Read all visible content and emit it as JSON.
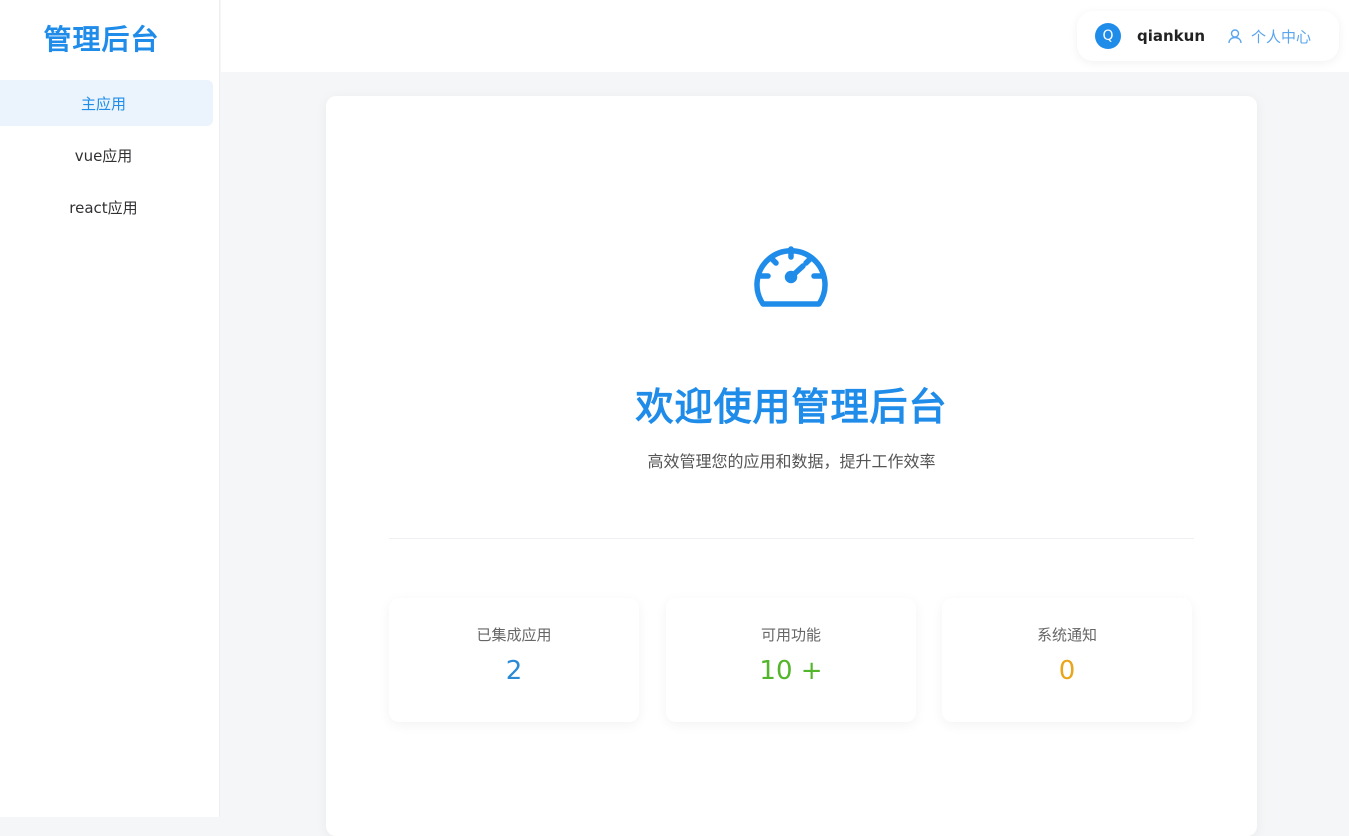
{
  "sidebar": {
    "logo": "管理后台",
    "items": [
      {
        "label": "主应用",
        "active": true
      },
      {
        "label": "vue应用",
        "active": false
      },
      {
        "label": "react应用",
        "active": false
      }
    ]
  },
  "header": {
    "avatar_letter": "Q",
    "username": "qiankun",
    "profile_label": "个人中心",
    "profile_icon": "user-icon"
  },
  "main": {
    "icon": "dashboard-icon",
    "title": "欢迎使用管理后台",
    "subtitle": "高效管理您的应用和数据，提升工作效率",
    "stats": [
      {
        "label": "已集成应用",
        "value": "2",
        "color": "#2a8ad6"
      },
      {
        "label": "可用功能",
        "value": "10 +",
        "color": "#52b52a"
      },
      {
        "label": "系统通知",
        "value": "0",
        "color": "#e9a61a"
      }
    ]
  },
  "colors": {
    "primary": "#1f8cea",
    "active_bg": "#ebf4fd",
    "background": "#f5f6f7"
  }
}
